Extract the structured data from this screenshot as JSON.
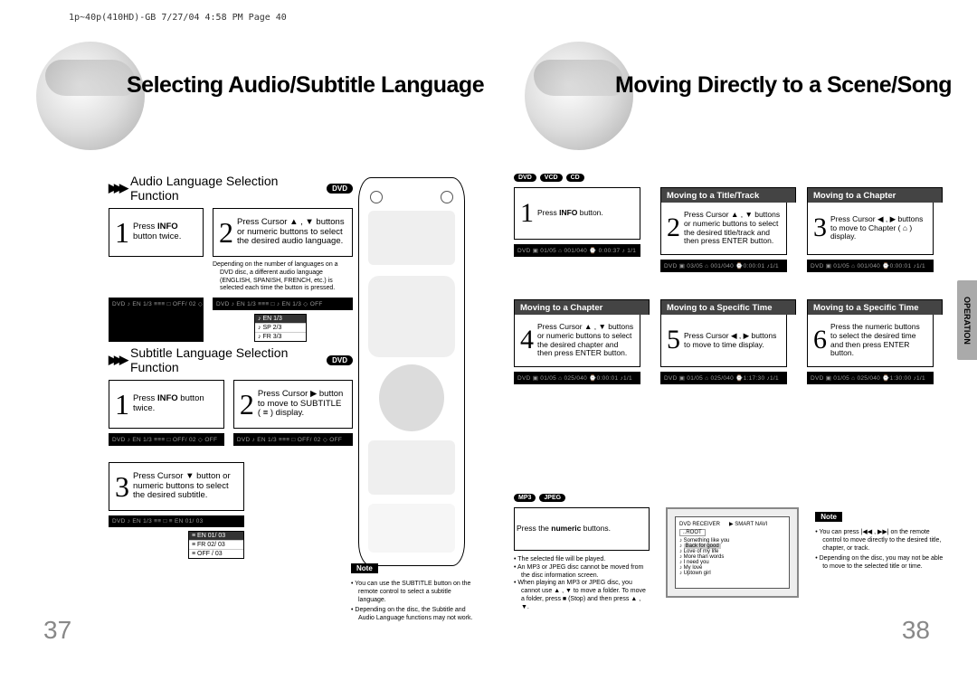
{
  "header": {
    "imprint": "1p~40p(410HD)-GB  7/27/04 4:58 PM  Page 40"
  },
  "left_page": {
    "title": "Selecting Audio/Subtitle Language",
    "page_num": "37",
    "audio": {
      "heading": "Audio Language Selection Function",
      "badge": "DVD",
      "step1": "Press INFO button twice.",
      "step2": "Press Cursor ▲ , ▼ buttons or numeric buttons to select the desired audio language.",
      "note": "Depending on the number of languages on a DVD disc, a different audio language (ENGLISH, SPANISH, FRENCH, etc.) is selected each time the button is pressed.",
      "osd1": "DVD  ♪ EN 1/3  ≡≡≡  □ OFF/ 02  ◇ OFF",
      "osd2": "DVD  ♪ EN 1/3  ≡≡≡  □ ♪ EN 1/3  ◇ OFF",
      "popup": [
        "♪ EN 1/3",
        "♪ SP 2/3",
        "♪ FR 3/3"
      ]
    },
    "subtitle": {
      "heading": "Subtitle Language Selection Function",
      "badge": "DVD",
      "step1": "Press INFO button twice.",
      "step2": "Press Cursor ▶ button to move to SUBTITLE ( ≡ ) display.",
      "step3": "Press Cursor ▼ button or numeric buttons to select the desired subtitle.",
      "osd1": "DVD  ♪ EN 1/3  ≡≡≡  □ OFF/ 02  ◇ OFF",
      "osd2": "DVD  ♪ EN 1/3  ≡≡≡  □ OFF/ 02  ◇ OFF",
      "popup": [
        "≡ EN 01/ 03",
        "≡ FR 02/ 03",
        "≡ OFF / 03"
      ]
    },
    "note_label": "Note",
    "footnotes": [
      "• You can use the SUBTITLE button on the remote control to select a subtitle language.",
      "• Depending on the disc, the Subtitle and Audio Language functions may not work."
    ]
  },
  "right_page": {
    "title": "Moving Directly to a Scene/Song",
    "page_num": "38",
    "op_tab": "OPERATION",
    "top_badges": [
      "DVD",
      "VCD",
      "CD"
    ],
    "row1": {
      "h1": "",
      "h2": "Moving to a Title/Track",
      "h3": "Moving to a Chapter",
      "s1": "Press INFO button.",
      "s2": "Press Cursor ▲ , ▼ buttons or numeric buttons to select the desired title/track and then press ENTER button.",
      "s3": "Press Cursor ◀ , ▶ buttons to move to Chapter ( ⌂ ) display."
    },
    "row2": {
      "h1": "Moving to a Chapter",
      "h2": "Moving to a Specific Time",
      "h3": "Moving to a Specific Time",
      "s4": "Press Cursor ▲ , ▼ buttons or numeric buttons to select the desired chapter and then press ENTER button.",
      "s5": "Press Cursor ◀ , ▶ buttons to move to time display.",
      "s6": "Press the numeric buttons to select the desired time and then press ENTER button."
    },
    "osd_example": "DVD  ▣ 01/05   ⌂ 001/040  ⌚ 0:00:37  ♪ 1/1",
    "bottom_badges": [
      "MP3",
      "JPEG"
    ],
    "numeric_step": "Press the numeric buttons.",
    "numeric_notes": [
      "• The selected file will be played.",
      "• An MP3 or JPEG disc cannot be moved from the disc information screen.",
      "• When playing an MP3 or JPEG disc, you cannot use ▲ , ▼ to move a folder. To move a folder, press ■ (Stop) and then press ▲ , ▼."
    ],
    "note_label": "Note",
    "footnotes": [
      "• You can press |◀◀ , ▶▶| on the remote control to move directly to the desired title, chapter, or track.",
      "• Depending on the disc, you may not be able to move to the selected title or time."
    ],
    "screen_lines": [
      "Something like you",
      "Back for good",
      "Love of my life",
      "More than words",
      "I need you",
      "My love",
      "Uptown girl"
    ]
  }
}
